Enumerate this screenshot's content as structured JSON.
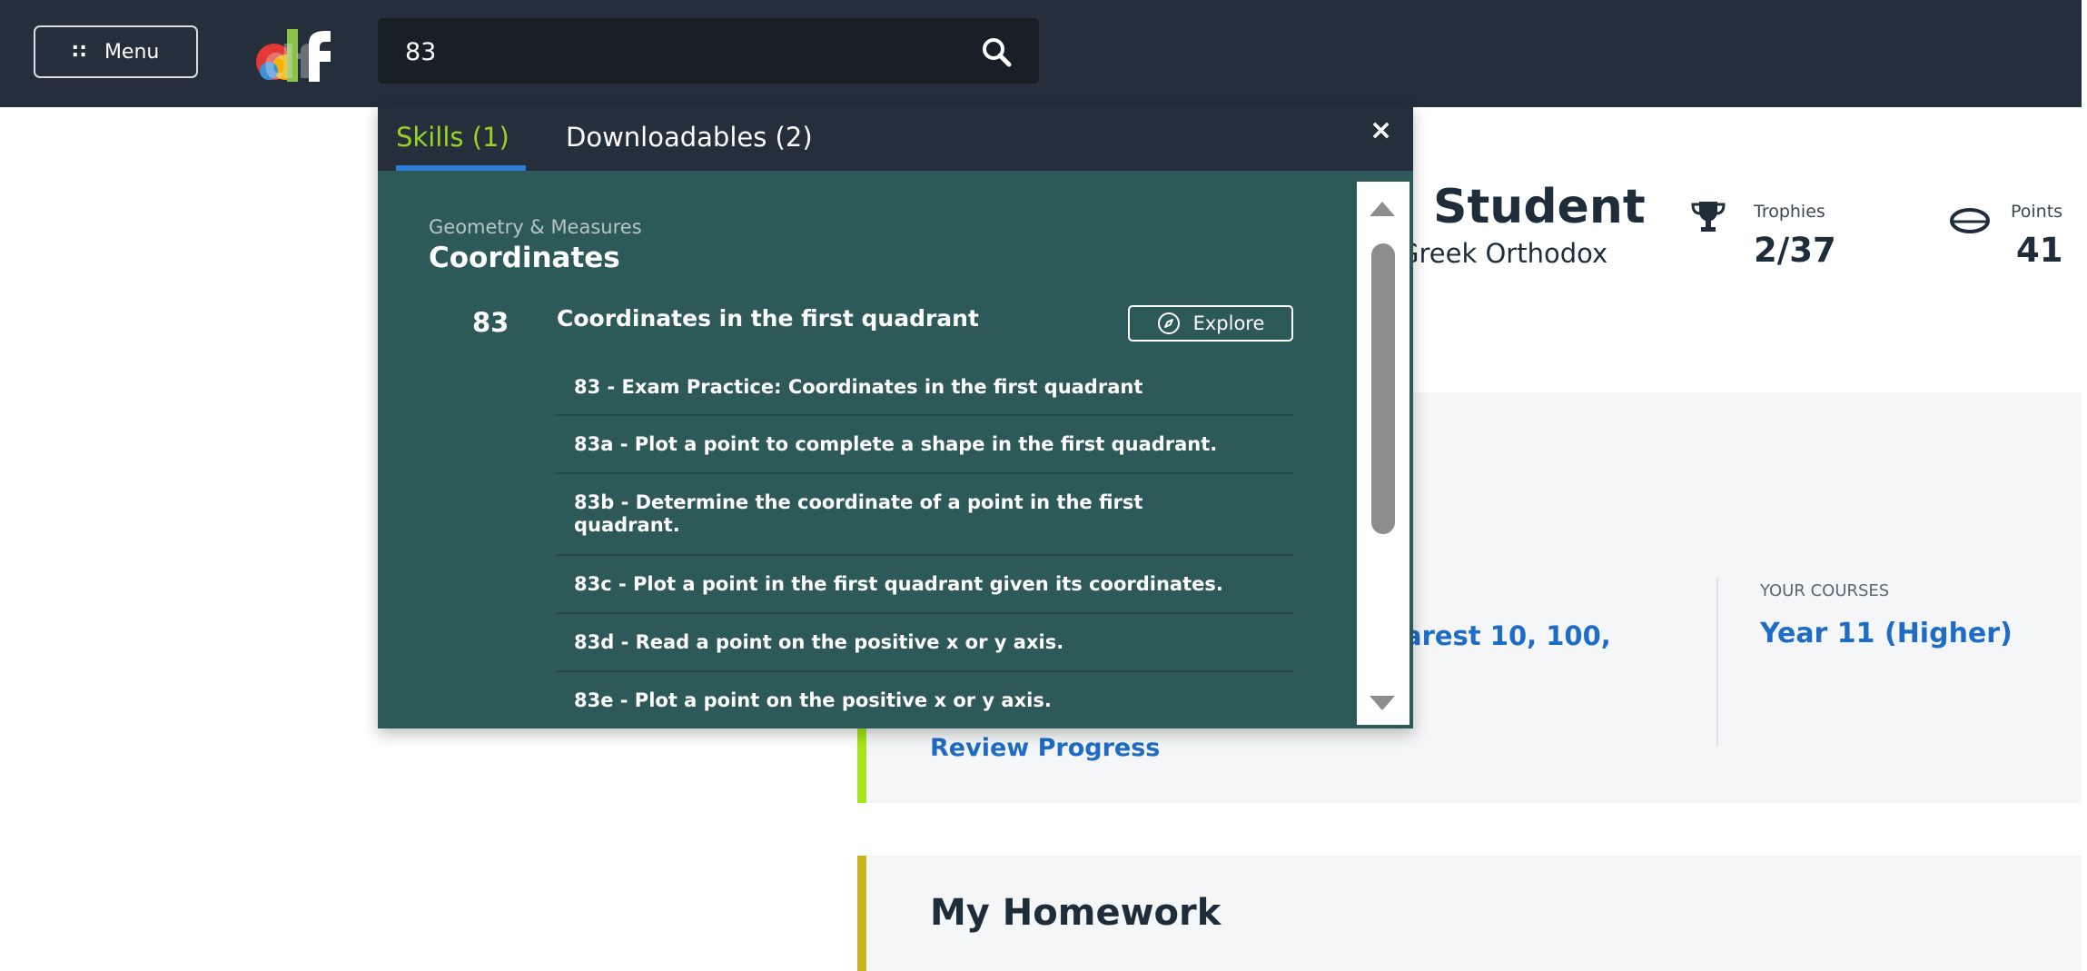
{
  "header": {
    "menu_label": "Menu",
    "menu_icon": "dots-icon",
    "logo_text": "df",
    "search": {
      "value": "83",
      "icon": "search-icon"
    }
  },
  "search_results": {
    "tabs": [
      {
        "label": "Skills (1)",
        "active": true
      },
      {
        "label": "Downloadables (2)",
        "active": false
      }
    ],
    "close_label": "×",
    "category": "Geometry & Measures",
    "topic": "Coordinates",
    "skill": {
      "number": "83",
      "title": "Coordinates in the first quadrant",
      "explore_label": "Explore"
    },
    "sub_skills": [
      "83 - Exam Practice: Coordinates in the first quadrant",
      "83a - Plot a point to complete a shape in the first quadrant.",
      "83b - Determine the coordinate of a point in the first quadrant.",
      "83c - Plot a point in the first quadrant given its coordinates.",
      "83d - Read a point on the positive x or y axis.",
      "83e - Plot a point on the positive x or y axis."
    ]
  },
  "profile": {
    "name_partial": "Student",
    "school_partial": "Greek Orthodox",
    "trophies_label": "Trophies",
    "trophies_value": "2/37",
    "points_label": "Points",
    "points_value": "41"
  },
  "progress_panel": {
    "skill_partial": "arest 10, 100,",
    "review_label": "Review Progress",
    "courses_label": "YOUR COURSES",
    "course_name": "Year 11 (Higher)"
  },
  "homework": {
    "title": "My Homework"
  },
  "colors": {
    "topbar": "#252f3b",
    "dropdown": "#2d5959",
    "active_tab": "#9bd123",
    "link": "#1f6cc7",
    "progress_accent": "#a4e61b",
    "homework_accent": "#c9b41d"
  }
}
